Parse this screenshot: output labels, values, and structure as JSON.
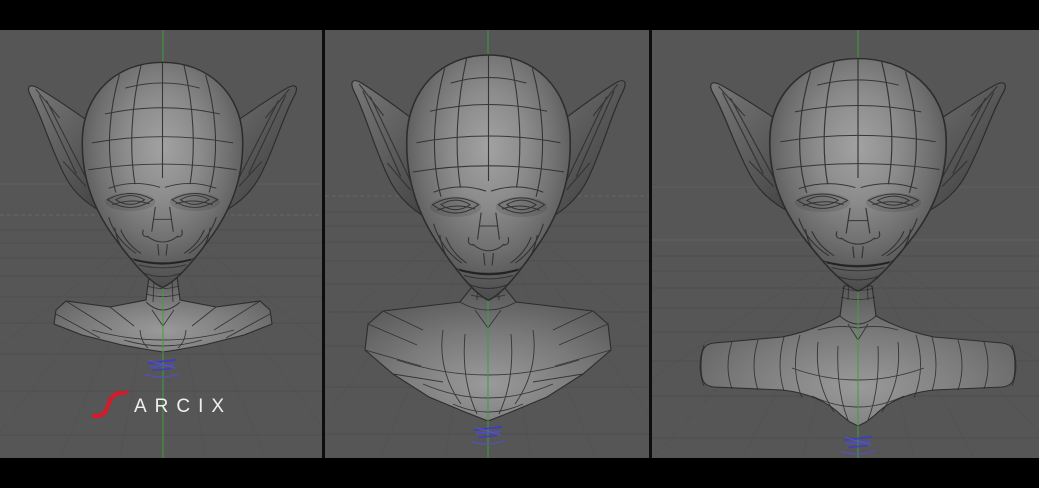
{
  "scene": {
    "background_color": "#000000",
    "viewport_color": "#565656",
    "divider_color": "#0d0d0d",
    "axis_line_color": "#3f9e39",
    "gizmo_color": "#4040cc",
    "grid_color": "#4e4e4e",
    "horizon_color": "#6e6e6e",
    "wireframe_color": "#2d2d2d",
    "model_shade_light": "#a2a2a2",
    "model_shade_dark": "#404040"
  },
  "watermark": {
    "text": "SARCIX",
    "first_letter": "S",
    "rest": "ARCIX",
    "first_letter_color": "#d6192b",
    "text_color": "#f0f0f0"
  },
  "panels": [
    {
      "name": "left-viewport"
    },
    {
      "name": "center-viewport"
    },
    {
      "name": "right-viewport"
    }
  ]
}
